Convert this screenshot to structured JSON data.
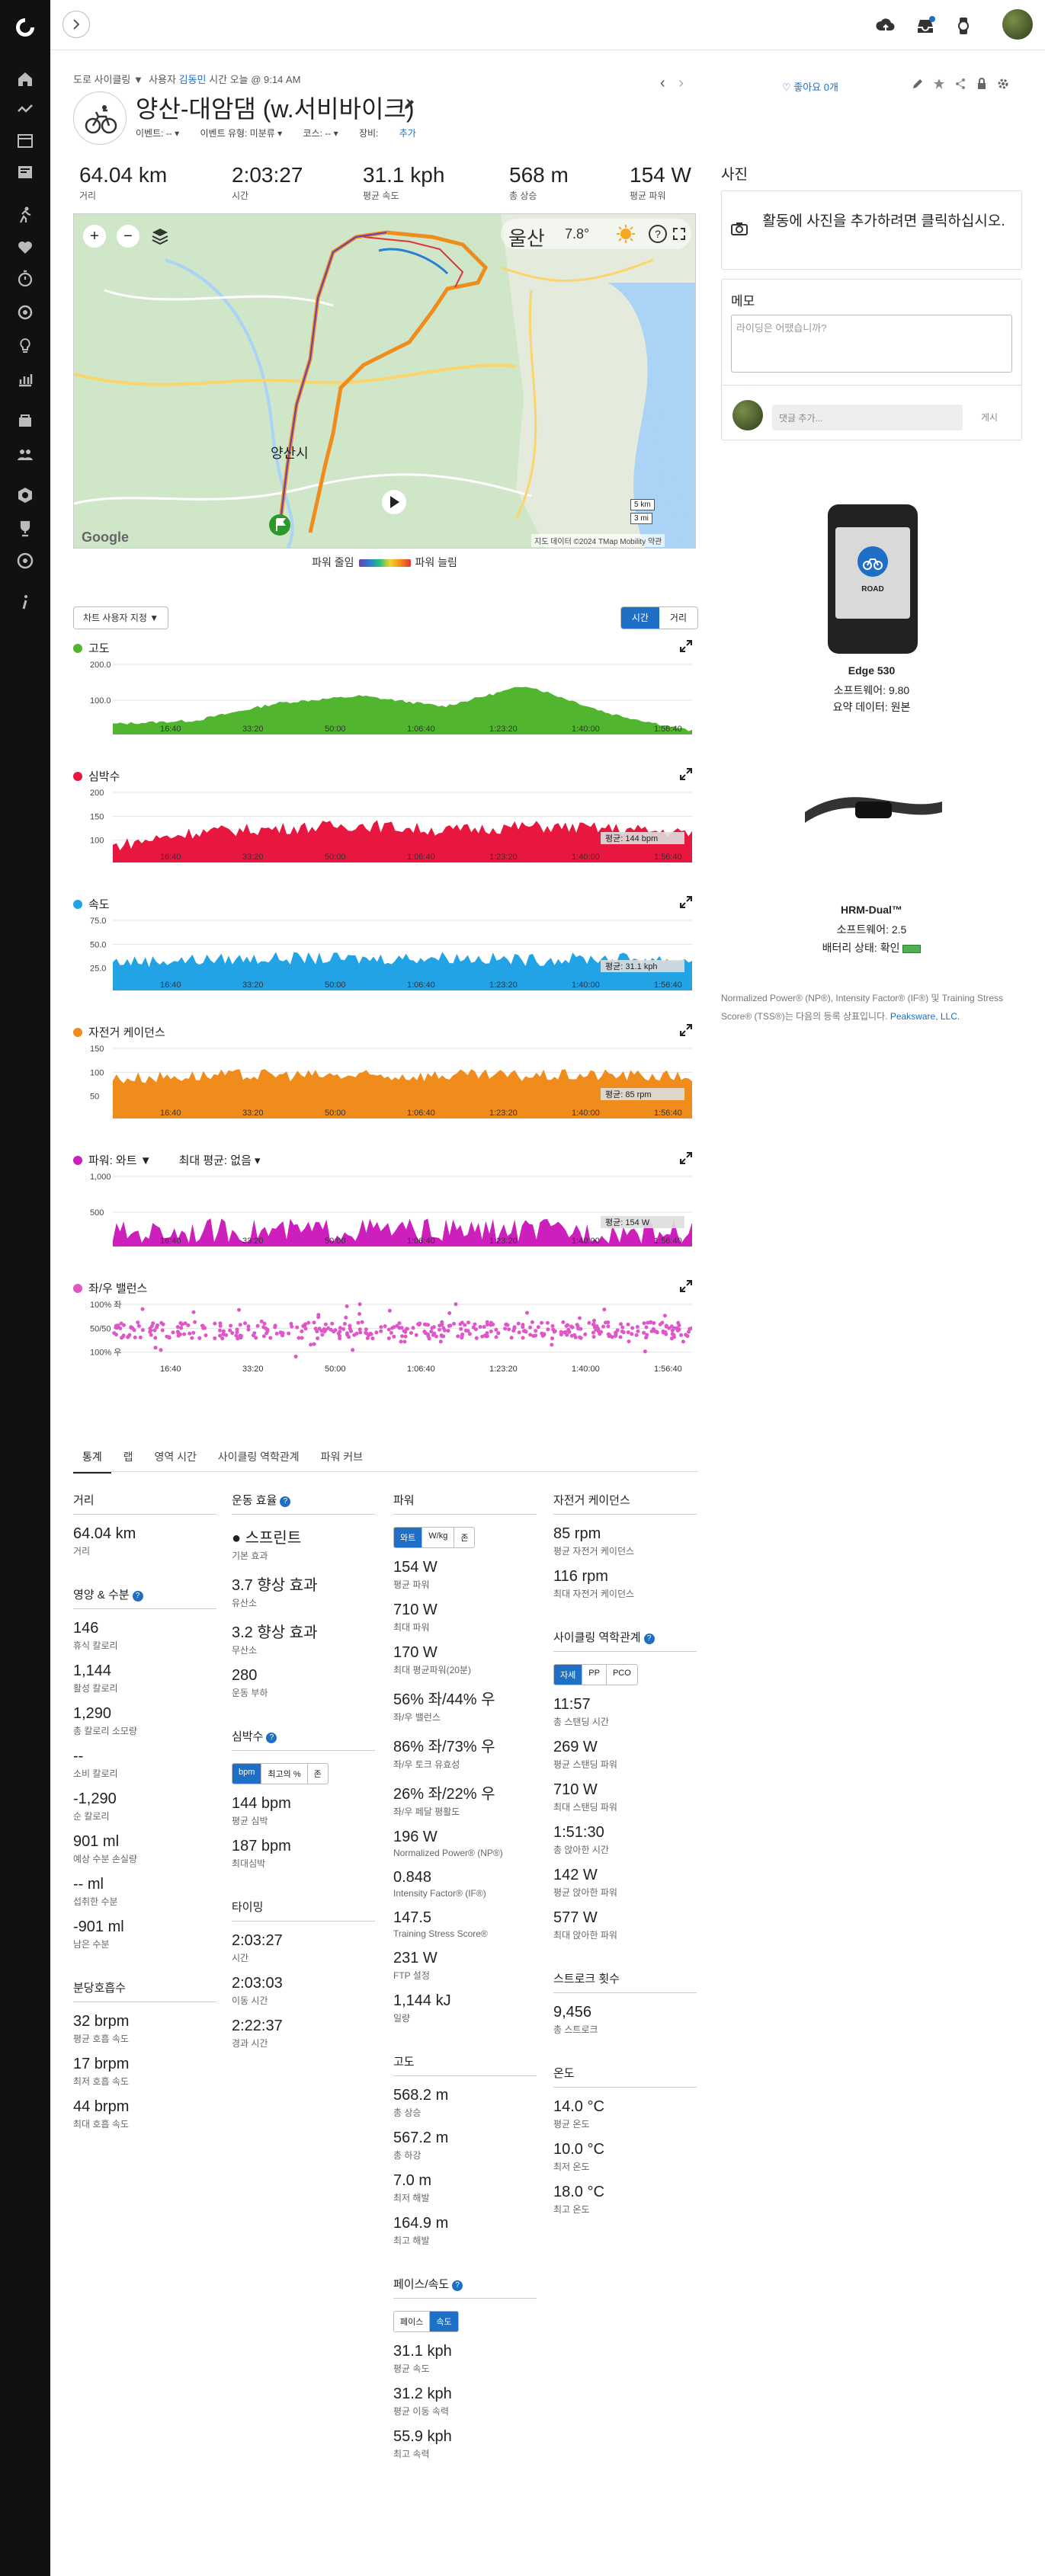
{
  "topbar": {
    "icons": [
      "upload-icon",
      "inbox-icon",
      "watch-icon",
      "profile-avatar"
    ]
  },
  "header": {
    "breadcrumb_type": "도로 사이클링 ▼",
    "breadcrumb_user_label": "사용자",
    "breadcrumb_user": "김동민",
    "breadcrumb_time": "시간 오늘 @ 9:14 AM",
    "title": "양산-대암댐 (w.서비바이크)",
    "event_label": "이벤트: -- ▾",
    "event_type_label": "이벤트 유형: 미분류 ▾",
    "course_label": "코스: -- ▾",
    "gear_label": "장비:",
    "gear_link": "추가",
    "likes": "좋아요 0개"
  },
  "summary": [
    {
      "value": "64.04 km",
      "label": "거리"
    },
    {
      "value": "2:03:27",
      "label": "시간"
    },
    {
      "value": "31.1 kph",
      "label": "평균 속도"
    },
    {
      "value": "568 m",
      "label": "총 상승"
    },
    {
      "value": "154 W",
      "label": "평균 파워"
    }
  ],
  "map": {
    "weather": "7.8°",
    "city_label": "울산",
    "scale_km": "5 km",
    "scale_mi": "3 mi",
    "attribution": "지도 데이터 ©2024 TMap Mobility   약관",
    "google": "Google",
    "place_yangsan": "양산시",
    "zoom_in": "+",
    "zoom_out": "−",
    "help": "?"
  },
  "legend": {
    "left": "파워 줄임",
    "right": "파워 늘림"
  },
  "chart_controls": {
    "customize": "차트 사용자 지정 ▼",
    "time": "시간",
    "distance": "거리"
  },
  "charts": [
    {
      "name": "고도",
      "color": "#52b52f",
      "yticks": [
        "200.0",
        "100.0"
      ],
      "avg": ""
    },
    {
      "name": "심박수",
      "color": "#e8173f",
      "yticks": [
        "200",
        "150",
        "100"
      ],
      "avg": "평균: 144 bpm"
    },
    {
      "name": "속도",
      "color": "#21a3e5",
      "yticks": [
        "75.0",
        "50.0",
        "25.0"
      ],
      "avg": "평균: 31.1 kph"
    },
    {
      "name": "자전거 케이던스",
      "color": "#f08c1c",
      "yticks": [
        "150",
        "100",
        "50"
      ],
      "avg": "평균: 85 rpm"
    },
    {
      "name": "파워: 와트 ▼",
      "color": "#cc1fbb",
      "yticks": [
        "1,000",
        "500"
      ],
      "avg": "평균: 154 W",
      "extra": "최대 평균: 없음 ▾"
    },
    {
      "name": "좌/우 밸런스",
      "color": "#e056c8",
      "yticks": [
        "100% 좌",
        "50/50",
        "100% 우"
      ],
      "avg": ""
    }
  ],
  "xticks": [
    "16:40",
    "33:20",
    "50:00",
    "1:06:40",
    "1:23:20",
    "1:40:00",
    "1:56:40"
  ],
  "chart_data": [
    {
      "type": "area",
      "title": "고도",
      "x": [
        0,
        16.7,
        33.3,
        50,
        66.7,
        83.3,
        100,
        116.7
      ],
      "xlabel": "",
      "series": [
        {
          "values": [
            30,
            40,
            90,
            110,
            80,
            140,
            60,
            10
          ]
        }
      ],
      "ylim": [
        0,
        200
      ]
    },
    {
      "type": "area",
      "title": "심박수",
      "series": [
        {
          "values": [
            120,
            140,
            145,
            150,
            142,
            148,
            145,
            138
          ]
        }
      ],
      "ylim": [
        100,
        200
      ]
    },
    {
      "type": "area",
      "title": "속도",
      "series": [
        {
          "values": [
            28,
            30,
            32,
            31,
            33,
            30,
            32,
            30
          ]
        }
      ],
      "ylim": [
        0,
        75
      ]
    },
    {
      "type": "area",
      "title": "자전거 케이던스",
      "series": [
        {
          "values": [
            80,
            86,
            88,
            85,
            87,
            86,
            88,
            84
          ]
        }
      ],
      "ylim": [
        0,
        150
      ]
    },
    {
      "type": "area",
      "title": "파워",
      "series": [
        {
          "values": [
            120,
            160,
            150,
            170,
            155,
            160,
            150,
            140
          ]
        }
      ],
      "ylim": [
        0,
        1000
      ]
    },
    {
      "type": "scatter",
      "title": "좌/우 밸런스",
      "series": [
        {
          "values": [
            50,
            52,
            48,
            51,
            49,
            50,
            52,
            50
          ]
        }
      ]
    }
  ],
  "tabs": [
    "통계",
    "랩",
    "영역 시간",
    "사이클링 역학관계",
    "파워 커브"
  ],
  "stats": {
    "distance": {
      "h": "거리",
      "items": [
        {
          "v": "64.04 km",
          "l": "거리"
        }
      ]
    },
    "nutrition": {
      "h": "영양 & 수분",
      "items": [
        {
          "v": "146",
          "l": "휴식 칼로리"
        },
        {
          "v": "1,144",
          "l": "활성 칼로리"
        },
        {
          "v": "1,290",
          "l": "총 칼로리 소모량"
        },
        {
          "v": "--",
          "l": "소비 칼로리"
        },
        {
          "v": "-1,290",
          "l": "순 칼로리"
        },
        {
          "v": "901 ml",
          "l": "예상 수분 손실량"
        },
        {
          "v": "-- ml",
          "l": "섭취한 수분"
        },
        {
          "v": "-901 ml",
          "l": "남은 수분"
        }
      ]
    },
    "resp": {
      "h": "분당호흡수",
      "items": [
        {
          "v": "32 brpm",
          "l": "평균 호흡 속도"
        },
        {
          "v": "17 brpm",
          "l": "최저 호흡 속도"
        },
        {
          "v": "44 brpm",
          "l": "최대 호흡 속도"
        }
      ]
    },
    "effect": {
      "h": "운동 효율",
      "items": [
        {
          "v": "● 스프린트",
          "l": "기본 효과"
        },
        {
          "v": "3.7 향상 효과",
          "l": "유산소"
        },
        {
          "v": "3.2 향상 효과",
          "l": "무산소"
        },
        {
          "v": "280",
          "l": "운동 부하"
        }
      ]
    },
    "hr": {
      "h": "심박수",
      "seg": [
        "bpm",
        "최고의 %",
        "존"
      ],
      "items": [
        {
          "v": "144 bpm",
          "l": "평균 심박"
        },
        {
          "v": "187 bpm",
          "l": "최대심박"
        }
      ]
    },
    "timing": {
      "h": "타이밍",
      "items": [
        {
          "v": "2:03:27",
          "l": "시간"
        },
        {
          "v": "2:03:03",
          "l": "이동 시간"
        },
        {
          "v": "2:22:37",
          "l": "경과 시간"
        }
      ]
    },
    "power": {
      "h": "파워",
      "seg": [
        "와트",
        "W/kg",
        "존"
      ],
      "items": [
        {
          "v": "154 W",
          "l": "평균 파워"
        },
        {
          "v": "710 W",
          "l": "최대 파워"
        },
        {
          "v": "170 W",
          "l": "최대 평균파워(20분)"
        },
        {
          "v": "56% 좌/44% 우",
          "l": "좌/우 밸런스"
        },
        {
          "v": "86% 좌/73% 우",
          "l": "좌/우 토크 유효성"
        },
        {
          "v": "26% 좌/22% 우",
          "l": "좌/우 페달 평활도"
        },
        {
          "v": "196 W",
          "l": "Normalized Power® (NP®)"
        },
        {
          "v": "0.848",
          "l": "Intensity Factor® (IF®)"
        },
        {
          "v": "147.5",
          "l": "Training Stress Score®"
        },
        {
          "v": "231 W",
          "l": "FTP 설정"
        },
        {
          "v": "1,144 kJ",
          "l": "일량"
        }
      ]
    },
    "elev": {
      "h": "고도",
      "items": [
        {
          "v": "568.2 m",
          "l": "총 상승"
        },
        {
          "v": "567.2 m",
          "l": "총 하강"
        },
        {
          "v": "7.0 m",
          "l": "최저 해발"
        },
        {
          "v": "164.9 m",
          "l": "최고 해발"
        }
      ]
    },
    "pace": {
      "h": "페이스/속도",
      "seg": [
        "페이스",
        "속도"
      ],
      "items": [
        {
          "v": "31.1 kph",
          "l": "평균 속도"
        },
        {
          "v": "31.2 kph",
          "l": "평균 이동 속력"
        },
        {
          "v": "55.9 kph",
          "l": "최고 속력"
        }
      ]
    },
    "cadence": {
      "h": "자전거 케이던스",
      "items": [
        {
          "v": "85 rpm",
          "l": "평균 자전거 케이던스"
        },
        {
          "v": "116 rpm",
          "l": "최대 자전거 케이던스"
        }
      ]
    },
    "dyn": {
      "h": "사이클링 역학관계",
      "seg": [
        "자세",
        "PP",
        "PCO"
      ],
      "items": [
        {
          "v": "11:57",
          "l": "총 스탠딩 시간"
        },
        {
          "v": "269 W",
          "l": "평균 스탠딩 파워"
        },
        {
          "v": "710 W",
          "l": "최대 스탠딩 파워"
        },
        {
          "v": "1:51:30",
          "l": "총 앉아한 시간"
        },
        {
          "v": "142 W",
          "l": "평균 앉아한 파워"
        },
        {
          "v": "577 W",
          "l": "최대 앉아한 파워"
        }
      ]
    },
    "strokes": {
      "h": "스트로크 횟수",
      "items": [
        {
          "v": "9,456",
          "l": "총 스트로크"
        }
      ]
    },
    "temp": {
      "h": "온도",
      "items": [
        {
          "v": "14.0 °C",
          "l": "평균 온도"
        },
        {
          "v": "10.0 °C",
          "l": "최저 온도"
        },
        {
          "v": "18.0 °C",
          "l": "최고 온도"
        }
      ]
    }
  },
  "right": {
    "photos_h": "사진",
    "photos_cta": "활동에 사진을 추가하려면 클릭하십시오.",
    "memo_h": "메모",
    "memo_placeholder": "라이딩은 어땠습니까?",
    "comment_placeholder": "댓글 추가...",
    "post": "게시",
    "device1_name": "Edge 530",
    "device1_sw": "소프트웨어: 9.80",
    "device1_data": "요약 데이터: 원본",
    "device1_screen": "ROAD",
    "device2_name": "HRM-Dual™",
    "device2_sw": "소프트웨어: 2.5",
    "device2_batt": "배터리 상태: 확인",
    "tm_note": "Normalized Power® (NP®), Intensity Factor® (IF®) 및 Training Stress Score® (TSS®)는 다음의 등록 상표입니다.",
    "tm_link": "Peaksware, LLC."
  }
}
